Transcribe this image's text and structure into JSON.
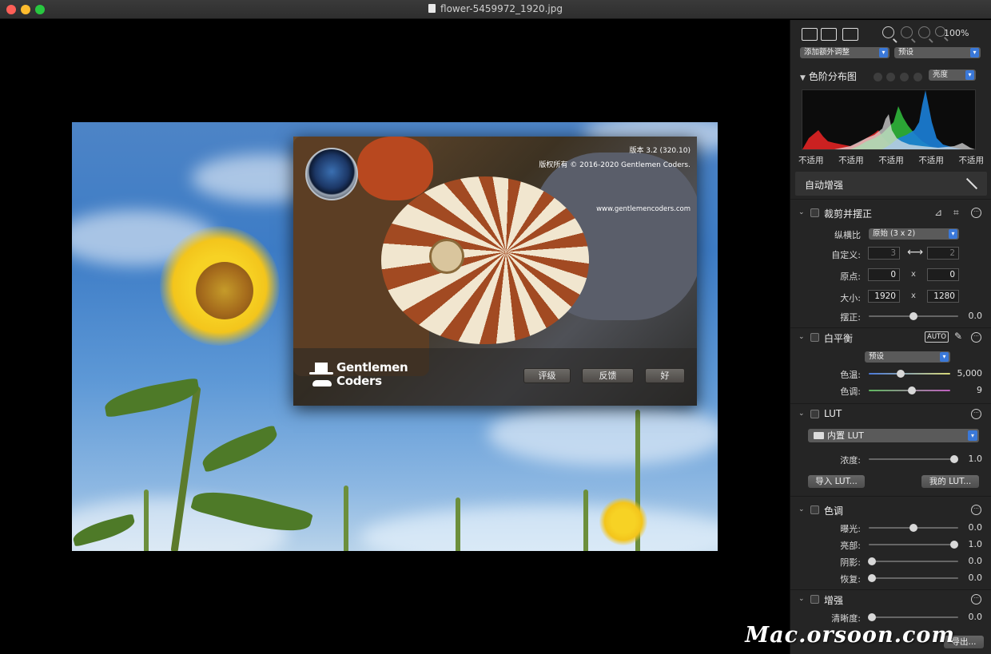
{
  "window": {
    "title": "flower-5459972_1920.jpg"
  },
  "about": {
    "version": "版本 3.2 (320.10)",
    "copyright": "版权所有 © 2016-2020 Gentlemen Coders.",
    "url": "www.gentlemencoders.com",
    "brand_line1": "Gentlemen",
    "brand_line2": "Coders",
    "rate_button": "评级",
    "feedback_button": "反馈",
    "ok_button": "好"
  },
  "toolbar": {
    "zoom_percent": "100%",
    "add_adjustment": "添加额外调整",
    "preset": "预设"
  },
  "histogram": {
    "title": "色阶分布图",
    "mode": "亮度",
    "readouts": [
      "不适用",
      "不适用",
      "不适用",
      "不适用",
      "不适用"
    ]
  },
  "auto_enhance": {
    "label": "自动增强"
  },
  "crop": {
    "title": "裁剪并摆正",
    "aspect_label": "纵横比",
    "aspect_value": "原始 (3 x 2)",
    "custom_label": "自定义:",
    "custom_w": "3",
    "custom_h": "2",
    "origin_label": "原点:",
    "origin_x": "0",
    "origin_y": "0",
    "size_label": "大小:",
    "size_w": "1920",
    "size_h": "1280",
    "x_sep": "x",
    "straighten_label": "摆正:",
    "straighten_value": "0.0"
  },
  "white_balance": {
    "title": "白平衡",
    "auto": "AUTO",
    "preset": "预设",
    "temp_label": "色温:",
    "temp_value": "5,000",
    "tint_label": "色调:",
    "tint_value": "9"
  },
  "lut": {
    "title": "LUT",
    "selected": "内置 LUT",
    "intensity_label": "浓度:",
    "intensity_value": "1.0",
    "import_button": "导入 LUT...",
    "mine_button": "我的 LUT..."
  },
  "tone": {
    "title": "色调",
    "rows": [
      {
        "label": "曝光:",
        "value": "0.0"
      },
      {
        "label": "亮部:",
        "value": "1.0"
      },
      {
        "label": "阴影:",
        "value": "0.0"
      },
      {
        "label": "恢复:",
        "value": "0.0"
      }
    ]
  },
  "enhance": {
    "title": "增强",
    "clarity_label": "清晰度:",
    "clarity_value": "0.0"
  },
  "bottom": {
    "export_button": "导出..."
  },
  "watermark": "Mac.orsoon.com"
}
